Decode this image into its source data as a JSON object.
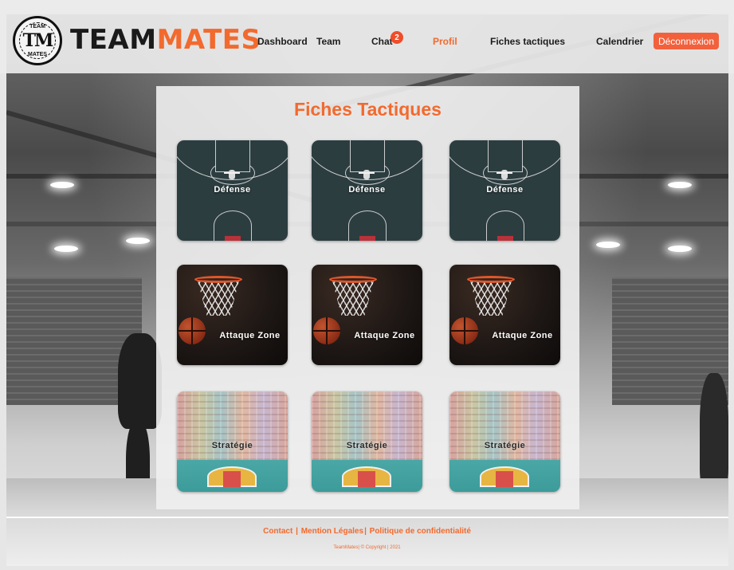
{
  "brand": {
    "part1": "TEAM",
    "part2": "MATES",
    "badge_top": "TEAM",
    "badge_mono": "TM",
    "badge_bottom": "MATES"
  },
  "nav": {
    "dashboard": "Dashboard",
    "team": "Team",
    "chat": "Chat",
    "chat_badge": "2",
    "profil": "Profil",
    "fiches": "Fiches tactiques",
    "calendrier": "Calendrier",
    "logout": "Déconnexion"
  },
  "main": {
    "title": "Fiches Tactiques",
    "cards": [
      {
        "label": "Défense",
        "kind": "defense"
      },
      {
        "label": "Défense",
        "kind": "defense"
      },
      {
        "label": "Défense",
        "kind": "defense"
      },
      {
        "label": "Attaque Zone",
        "kind": "attack"
      },
      {
        "label": "Attaque Zone",
        "kind": "attack"
      },
      {
        "label": "Attaque Zone",
        "kind": "attack"
      },
      {
        "label": "Stratégie",
        "kind": "strategy"
      },
      {
        "label": "Stratégie",
        "kind": "strategy"
      },
      {
        "label": "Stratégie",
        "kind": "strategy"
      }
    ]
  },
  "footer": {
    "contact": "Contact",
    "sep1": "|",
    "mentions": "Mention Légales",
    "sep2": "|",
    "privacy": "Politique de confidentialité",
    "copyright": "TeamMates| © Copyright | 2021"
  },
  "colors": {
    "accent": "#f26a2e",
    "logout_bg": "#f2613c",
    "badge_bg": "#ef4e2a"
  }
}
